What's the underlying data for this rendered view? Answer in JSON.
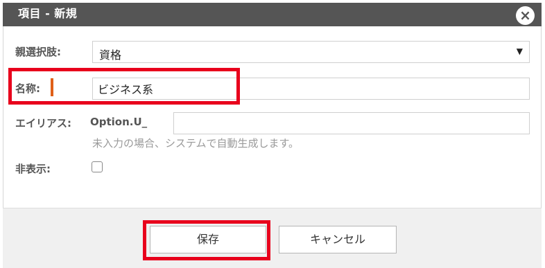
{
  "dialog": {
    "title": "項目 - 新規",
    "close_glyph": "×"
  },
  "form": {
    "parent_option": {
      "label": "親選択肢:",
      "value": "資格",
      "arrow_glyph": "▼"
    },
    "name": {
      "label": "名称:",
      "value": "ビジネス系"
    },
    "alias": {
      "label": "エイリアス:",
      "prefix": "Option.U_",
      "value": "",
      "hint": "未入力の場合、システムで自動生成します。"
    },
    "hidden": {
      "label": "非表示:",
      "checked": false
    }
  },
  "footer": {
    "save_label": "保存",
    "cancel_label": "キャンセル"
  },
  "colors": {
    "titlebar": "#555555",
    "required_marker": "#e06018",
    "highlight": "#e8001c"
  }
}
